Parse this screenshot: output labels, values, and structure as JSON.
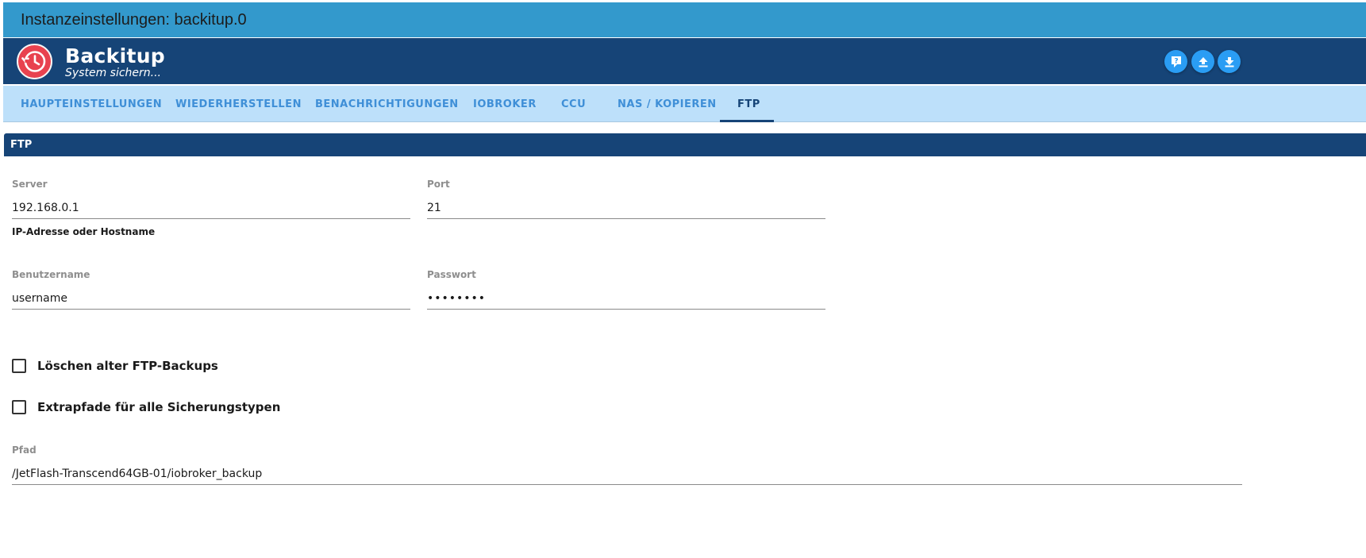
{
  "window": {
    "title": "Instanzeinstellungen: backitup.0"
  },
  "header": {
    "app_name": "Backitup",
    "tagline": "System sichern...",
    "logo_icon": "backup-clock-icon",
    "buttons": [
      {
        "icon": "help-icon"
      },
      {
        "icon": "upload-icon"
      },
      {
        "icon": "download-icon"
      }
    ]
  },
  "tabs": [
    {
      "label": "HAUPTEINSTELLUNGEN",
      "active": false
    },
    {
      "label": "WIEDERHERSTELLEN",
      "active": false
    },
    {
      "label": "BENACHRICHTIGUNGEN",
      "active": false
    },
    {
      "label": "IOBROKER",
      "active": false
    },
    {
      "label": "CCU",
      "active": false
    },
    {
      "label": "NAS / KOPIEREN",
      "active": false
    },
    {
      "label": "FTP",
      "active": true
    }
  ],
  "section": {
    "title": "FTP"
  },
  "form": {
    "server": {
      "label": "Server",
      "value": "192.168.0.1",
      "help": "IP-Adresse oder Hostname"
    },
    "port": {
      "label": "Port",
      "value": "21"
    },
    "username": {
      "label": "Benutzername",
      "value": "username"
    },
    "password": {
      "label": "Passwort",
      "value": "••••••••"
    },
    "delete_old": {
      "label": "Löschen alter FTP-Backups",
      "checked": false
    },
    "extra_paths": {
      "label": "Extrapfade für alle Sicherungstypen",
      "checked": false
    },
    "path": {
      "label": "Pfad",
      "value": "/JetFlash-Transcend64GB-01/iobroker_backup"
    }
  },
  "colors": {
    "title_bar": "#3399cc",
    "header_bar": "#164477",
    "tabs_bar": "#bde0fa",
    "tab_text": "#3f8fd7",
    "logo": "#e8424f",
    "header_buttons": "#2a9df4"
  }
}
